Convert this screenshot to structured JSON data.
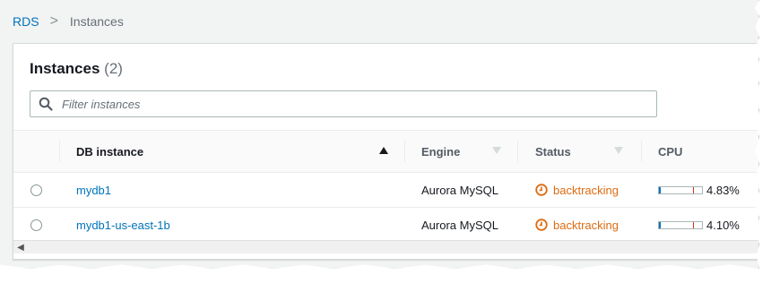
{
  "breadcrumb": {
    "root": "RDS",
    "separator": ">",
    "current": "Instances"
  },
  "panel": {
    "title": "Instances",
    "count": "(2)"
  },
  "filter": {
    "placeholder": "Filter instances",
    "icon": "search-icon"
  },
  "table": {
    "columns": [
      {
        "label": "DB instance",
        "sort": "ascending"
      },
      {
        "label": "Engine",
        "sort": "none"
      },
      {
        "label": "Status",
        "sort": "none"
      },
      {
        "label": "CPU",
        "sort": "none"
      }
    ],
    "rows": [
      {
        "name": "mydb1",
        "engine": "Aurora MySQL",
        "status": "backtracking",
        "cpu": "4.83%",
        "cpu_value": 4.83
      },
      {
        "name": "mydb1-us-east-1b",
        "engine": "Aurora MySQL",
        "status": "backtracking",
        "cpu": "4.10%",
        "cpu_value": 4.1
      }
    ]
  },
  "colors": {
    "link": "#0073bb",
    "status_warning": "#dd6b10",
    "text": "#16191f",
    "muted": "#687078"
  }
}
